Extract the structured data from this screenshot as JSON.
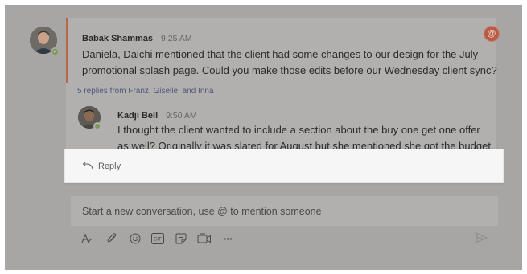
{
  "thread": {
    "message": {
      "author": "Babak Shammas",
      "time": "9:25 AM",
      "text_line1": "Daniela, Daichi mentioned that the client had some changes to our design for the July",
      "text_line2": "promotional splash page. Could you make those edits before our Wednesday client sync?"
    },
    "replies_summary": "5 replies from Franz, Giselle, and Inna",
    "reply": {
      "author": "Kadji Bell",
      "time": "9:50 AM",
      "text_line1": "I thought the client wanted to include a section about the buy one get one offer",
      "text_line2": "as well? Originally it was slated for August but she mentioned she got the budget."
    },
    "mention_badge": "@",
    "reply_button_label": "Reply"
  },
  "compose": {
    "placeholder": "Start a new conversation, use @ to mention someone",
    "toolbar": [
      "format-icon",
      "attach-icon",
      "emoji-icon",
      "gif-icon",
      "sticker-icon",
      "meet-now-icon",
      "more-options-icon"
    ],
    "gif_label": "GIF",
    "more_label": "···"
  },
  "colors": {
    "accent_bar": "#b5664b",
    "mention_badge": "#b85b45",
    "presence_available": "#7a9a55",
    "link": "#4f567e"
  }
}
